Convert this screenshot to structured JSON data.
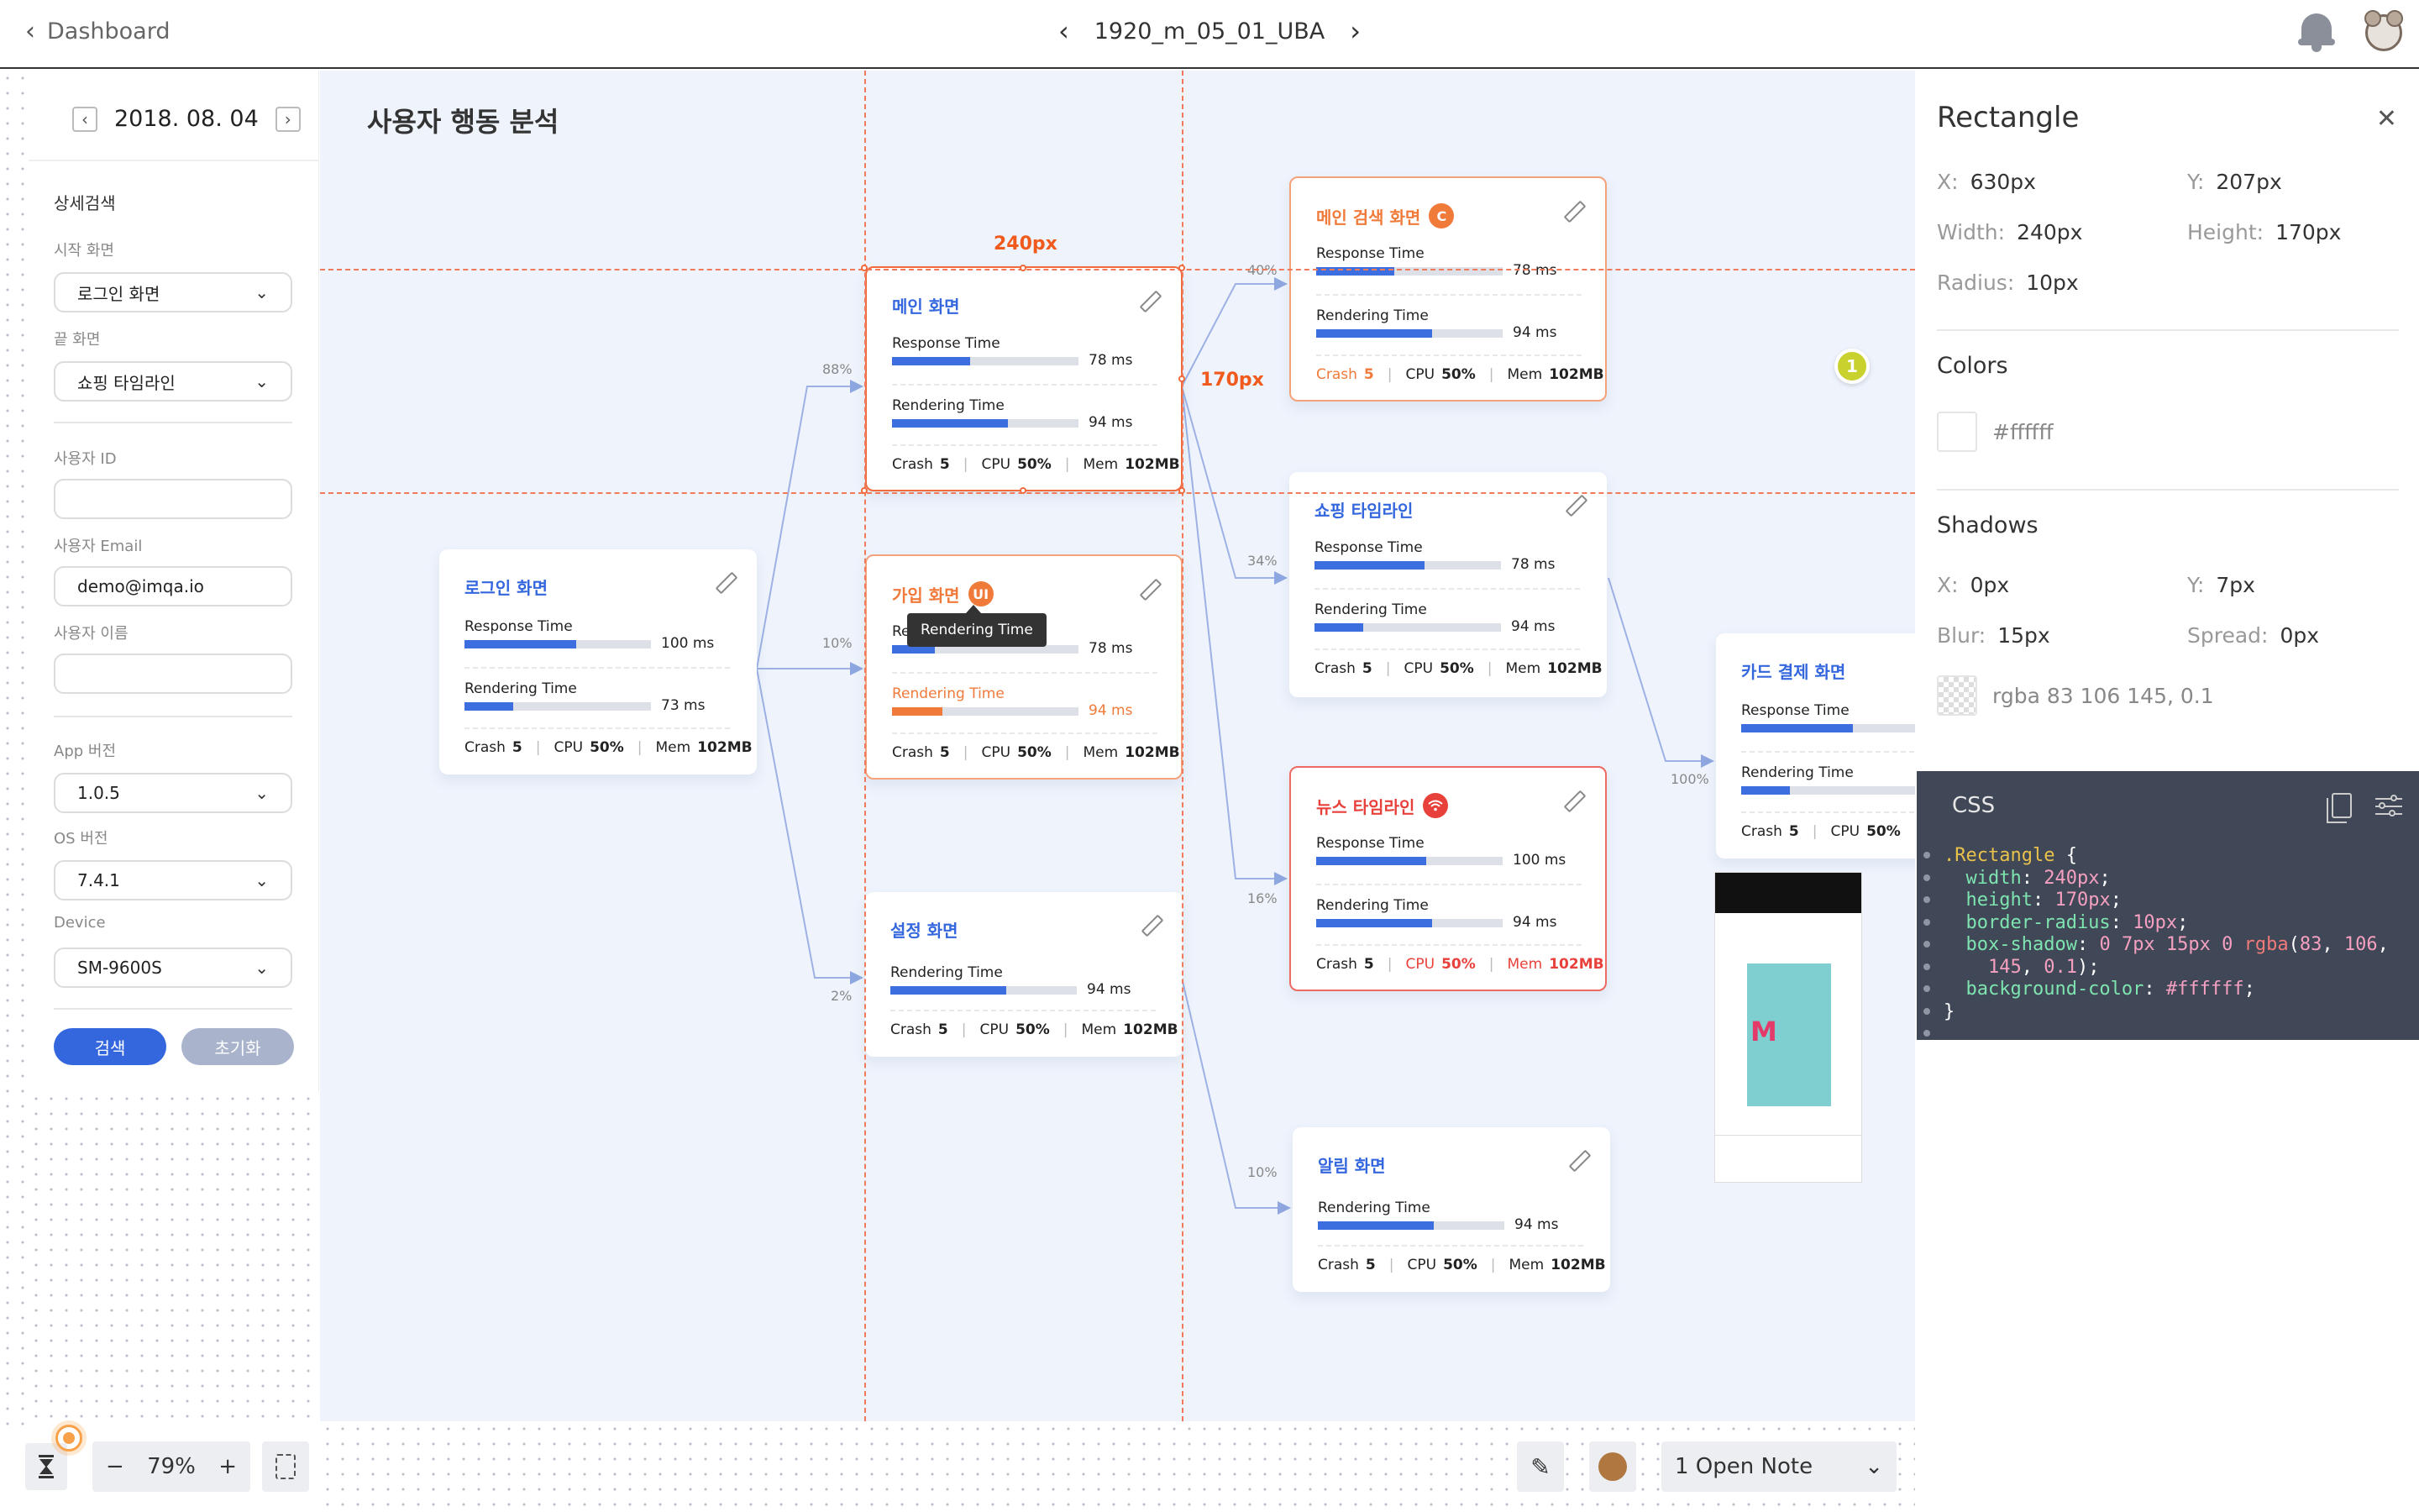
{
  "topbar": {
    "back_label": "Dashboard",
    "file_name": "1920_m_05_01_UBA"
  },
  "filters": {
    "date": "2018. 08. 04",
    "section_title": "상세검색",
    "start_screen_label": "시작 화면",
    "start_screen_value": "로그인 화면",
    "end_screen_label": "끝 화면",
    "end_screen_value": "쇼핑 타임라인",
    "user_id_label": "사용자 ID",
    "user_id_value": "",
    "user_email_label": "사용자 Email",
    "user_email_value": "demo@imqa.io",
    "user_name_label": "사용자 이름",
    "user_name_value": "",
    "app_version_label": "App 버전",
    "app_version_value": "1.0.5",
    "os_version_label": "OS 버전",
    "os_version_value": "7.4.1",
    "device_label": "Device",
    "device_value": "SM-9600S",
    "search_button": "검색",
    "reset_button": "초기화"
  },
  "canvas": {
    "title": "사용자 행동 분석",
    "width_label": "240px",
    "height_label": "170px",
    "tooltip": "Rendering Time",
    "pin_number": "1",
    "pct": {
      "p88": "88%",
      "p10": "10%",
      "p2": "2%",
      "p40": "40%",
      "p34": "34%",
      "p16": "16%",
      "p10b": "10%",
      "p100": "100%"
    }
  },
  "labels": {
    "response": "Response Time",
    "rendering": "Rendering Time",
    "crash": "Crash",
    "cpu": "CPU",
    "mem": "Mem"
  },
  "cards": {
    "login": {
      "title": "로그인 화면",
      "resp_val": "100 ms",
      "resp_fill": 0.6,
      "rend_val": "73 ms",
      "rend_fill": 0.26,
      "crash": "5",
      "cpu": "50%",
      "mem": "102MB"
    },
    "main": {
      "title": "메인 화면",
      "resp_val": "78 ms",
      "resp_fill": 0.42,
      "rend_val": "94 ms",
      "rend_fill": 0.62,
      "crash": "5",
      "cpu": "50%",
      "mem": "102MB"
    },
    "signup": {
      "title": "가입 화면",
      "badge": "UI",
      "resp_label_partial": "Re",
      "resp_val": "78 ms",
      "resp_fill": 0.23,
      "rend_val": "94 ms",
      "rend_fill": 0.27,
      "crash": "5",
      "cpu": "50%",
      "mem": "102MB"
    },
    "settings": {
      "title": "설정 화면",
      "rend_val": "94 ms",
      "rend_fill": 0.62,
      "crash": "5",
      "cpu": "50%",
      "mem": "102MB"
    },
    "main_search": {
      "title": "메인 검색 화면",
      "badge": "C",
      "resp_val": "78 ms",
      "resp_fill": 0.42,
      "rend_val": "94 ms",
      "rend_fill": 0.62,
      "crash": "5",
      "cpu": "50%",
      "mem": "102MB"
    },
    "shopping": {
      "title": "쇼핑 타임라인",
      "resp_val": "78 ms",
      "resp_fill": 0.59,
      "rend_val": "94 ms",
      "rend_fill": 0.26,
      "crash": "5",
      "cpu": "50%",
      "mem": "102MB"
    },
    "news": {
      "title": "뉴스 타임라인",
      "resp_val": "100 ms",
      "resp_fill": 0.59,
      "rend_val": "94 ms",
      "rend_fill": 0.62,
      "crash": "5",
      "cpu": "50%",
      "mem": "102MB"
    },
    "alarm": {
      "title": "알림 화면",
      "rend_val": "94 ms",
      "rend_fill": 0.62,
      "crash": "5",
      "cpu": "50%",
      "mem": "102MB"
    },
    "card_pay": {
      "title": "카드 결제 화면",
      "resp_fill": 0.6,
      "rend_fill": 0.26,
      "crash": "5",
      "cpu": "50%"
    }
  },
  "inspector": {
    "title": "Rectangle",
    "x_label": "X:",
    "x_value": "630px",
    "y_label": "Y:",
    "y_value": "207px",
    "w_label": "Width:",
    "w_value": "240px",
    "h_label": "Height:",
    "h_value": "170px",
    "r_label": "Radius:",
    "r_value": "10px",
    "colors_title": "Colors",
    "color_value": "#ffffff",
    "shadows_title": "Shadows",
    "sx_label": "X:",
    "sx_value": "0px",
    "sy_label": "Y:",
    "sy_value": "7px",
    "blur_label": "Blur:",
    "blur_value": "15px",
    "spread_label": "Spread:",
    "spread_value": "0px",
    "shadow_color": "rgba 83 106 145, 0.1",
    "css_title": "CSS"
  },
  "bottombar": {
    "zoom": "79%",
    "open_note": "1 Open Note"
  },
  "colors": {
    "accent": "#3467de",
    "selection": "#f06a3c",
    "canvas_bg": "#eef3fc"
  }
}
